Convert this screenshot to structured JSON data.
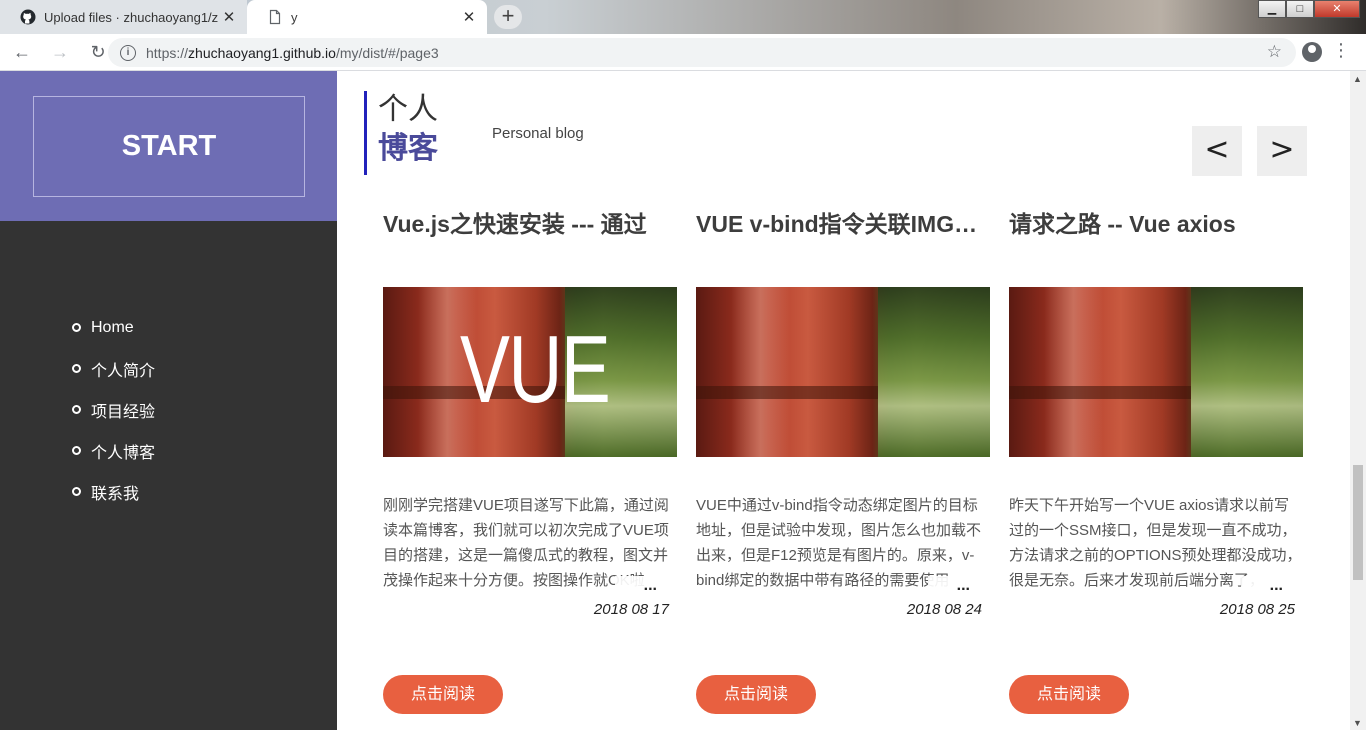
{
  "browser": {
    "tabs": [
      {
        "title": "Upload files · zhuchaoyang1/z",
        "active": false,
        "icon": "github-icon"
      },
      {
        "title": "y",
        "active": true,
        "icon": "page-icon"
      }
    ],
    "new_tab": "+",
    "url": {
      "scheme": "https://",
      "host": "zhuchaoyang1.github.io",
      "path": "/my/dist/#/page3"
    },
    "nav": {
      "back": "←",
      "forward": "→",
      "reload": "↻"
    },
    "window": {
      "minimize": "▁",
      "maximize": "□",
      "close": "✕"
    }
  },
  "sidebar": {
    "logo": "START",
    "items": [
      {
        "label": "Home"
      },
      {
        "label": "个人简介"
      },
      {
        "label": "项目经验"
      },
      {
        "label": "个人博客"
      },
      {
        "label": "联系我"
      }
    ],
    "colors": {
      "top": "#6e6db4",
      "bottom": "#333333"
    }
  },
  "header": {
    "title_line1": "个人",
    "title_line2": "博客",
    "subtitle": "Personal blog",
    "prev": "<",
    "next": ">"
  },
  "posts": [
    {
      "title": "Vue.js之快速安装 --- 通过",
      "image_text": "VUE",
      "excerpt": "刚刚学完搭建VUE项目遂写下此篇，通过阅读本篇博客，我们就可以初次完成了VUE项目的搭建，这是一篇傻瓜式的教程，图文并茂操作起来十分方便。按图操作就OK啦",
      "more": "...",
      "date": "2018 08 17",
      "button": "点击阅读"
    },
    {
      "title": "VUE v-bind指令关联IMG标签",
      "image_text": "",
      "excerpt": "VUE中通过v-bind指令动态绑定图片的目标地址，但是试验中发现，图片怎么也加载不出来，但是F12预览是有图片的。原来，v-bind绑定的数据中带有路径的需要使用",
      "more": "...",
      "date": "2018 08 24",
      "button": "点击阅读"
    },
    {
      "title": "请求之路 -- Vue axios",
      "image_text": "",
      "excerpt": "昨天下午开始写一个VUE axios请求以前写过的一个SSM接口，但是发现一直不成功，方法请求之前的OPTIONS预处理都没成功，很是无奈。后来才发现前后端分离了，",
      "more": "...",
      "date": "2018 08 25",
      "button": "点击阅读"
    }
  ],
  "accent_color": "#e86040"
}
